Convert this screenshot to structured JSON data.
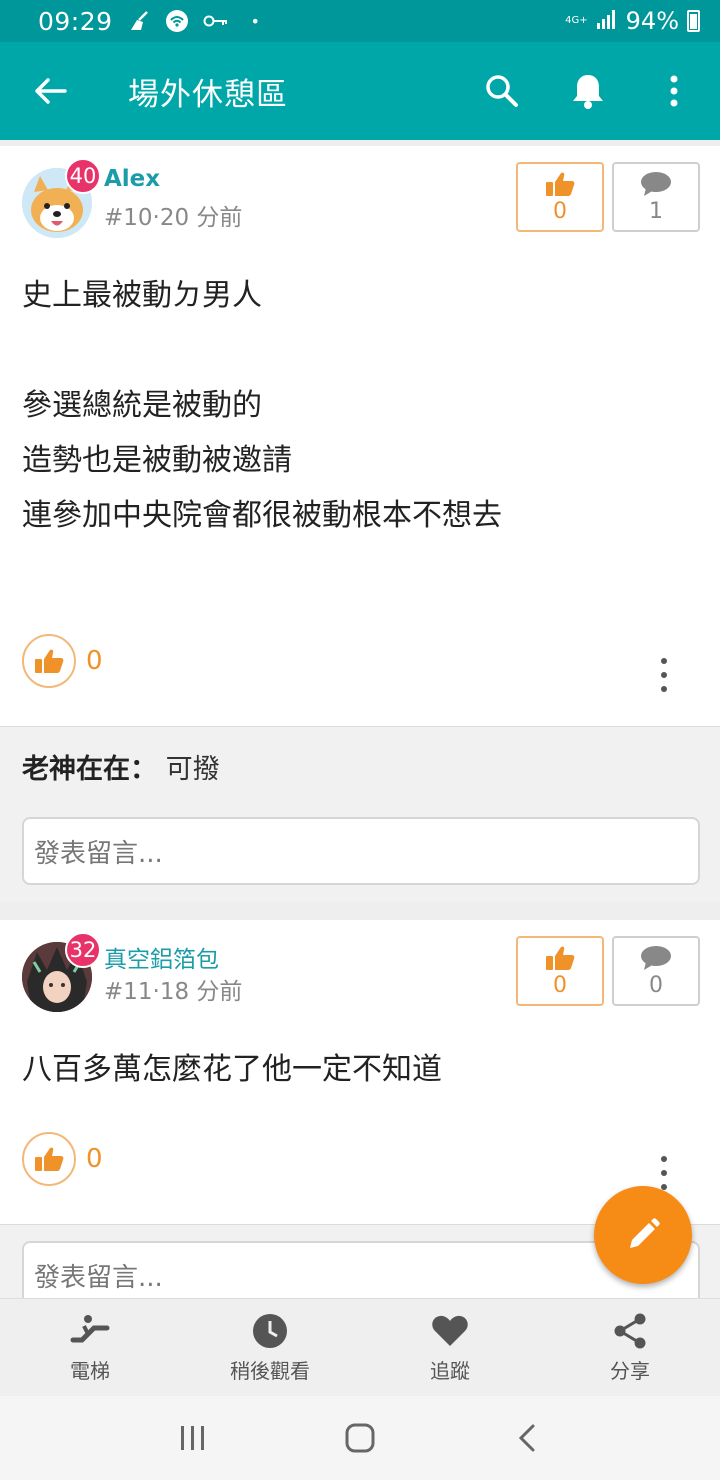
{
  "status_bar": {
    "time": "09:29",
    "network": "4G+",
    "battery": "94%"
  },
  "app_bar": {
    "title": "場外休憩區"
  },
  "posts": [
    {
      "level": "40",
      "author": "Alex",
      "meta": "#10‧20 分前",
      "likes": "0",
      "comments": "1",
      "content": "史上最被動ㄉ男人\n\n參選總統是被動的\n造勢也是被動被邀請\n連參加中央院會都很被動根本不想去",
      "like_count": "0",
      "reply_author": "老神在在：",
      "reply_text": "可撥",
      "comment_placeholder": "發表留言..."
    },
    {
      "level": "32",
      "author": "真空鋁箔包",
      "meta": "#11‧18 分前",
      "likes": "0",
      "comments": "0",
      "content": "八百多萬怎麼花了他一定不知道",
      "like_count": "0",
      "comment_placeholder": "發表留言..."
    }
  ],
  "bottom_nav": [
    {
      "label": "電梯",
      "icon": "escalator-icon"
    },
    {
      "label": "稍後觀看",
      "icon": "clock-icon"
    },
    {
      "label": "追蹤",
      "icon": "heart-icon"
    },
    {
      "label": "分享",
      "icon": "share-icon"
    }
  ],
  "colors": {
    "primary": "#00a7a9",
    "status": "#00979a",
    "accent": "#f68b15",
    "badge": "#e8336a",
    "author": "#1b9ca8"
  }
}
